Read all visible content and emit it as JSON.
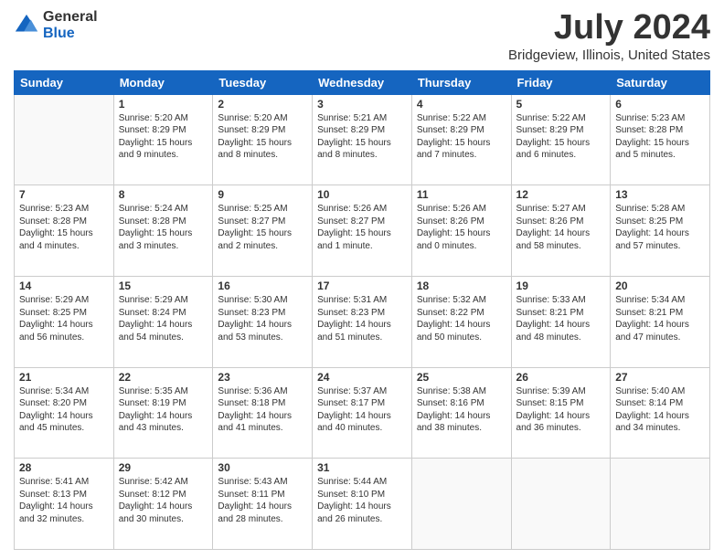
{
  "logo": {
    "general": "General",
    "blue": "Blue"
  },
  "title": "July 2024",
  "subtitle": "Bridgeview, Illinois, United States",
  "days_of_week": [
    "Sunday",
    "Monday",
    "Tuesday",
    "Wednesday",
    "Thursday",
    "Friday",
    "Saturday"
  ],
  "weeks": [
    [
      {
        "day": "",
        "info": ""
      },
      {
        "day": "1",
        "info": "Sunrise: 5:20 AM\nSunset: 8:29 PM\nDaylight: 15 hours\nand 9 minutes."
      },
      {
        "day": "2",
        "info": "Sunrise: 5:20 AM\nSunset: 8:29 PM\nDaylight: 15 hours\nand 8 minutes."
      },
      {
        "day": "3",
        "info": "Sunrise: 5:21 AM\nSunset: 8:29 PM\nDaylight: 15 hours\nand 8 minutes."
      },
      {
        "day": "4",
        "info": "Sunrise: 5:22 AM\nSunset: 8:29 PM\nDaylight: 15 hours\nand 7 minutes."
      },
      {
        "day": "5",
        "info": "Sunrise: 5:22 AM\nSunset: 8:29 PM\nDaylight: 15 hours\nand 6 minutes."
      },
      {
        "day": "6",
        "info": "Sunrise: 5:23 AM\nSunset: 8:28 PM\nDaylight: 15 hours\nand 5 minutes."
      }
    ],
    [
      {
        "day": "7",
        "info": "Sunrise: 5:23 AM\nSunset: 8:28 PM\nDaylight: 15 hours\nand 4 minutes."
      },
      {
        "day": "8",
        "info": "Sunrise: 5:24 AM\nSunset: 8:28 PM\nDaylight: 15 hours\nand 3 minutes."
      },
      {
        "day": "9",
        "info": "Sunrise: 5:25 AM\nSunset: 8:27 PM\nDaylight: 15 hours\nand 2 minutes."
      },
      {
        "day": "10",
        "info": "Sunrise: 5:26 AM\nSunset: 8:27 PM\nDaylight: 15 hours\nand 1 minute."
      },
      {
        "day": "11",
        "info": "Sunrise: 5:26 AM\nSunset: 8:26 PM\nDaylight: 15 hours\nand 0 minutes."
      },
      {
        "day": "12",
        "info": "Sunrise: 5:27 AM\nSunset: 8:26 PM\nDaylight: 14 hours\nand 58 minutes."
      },
      {
        "day": "13",
        "info": "Sunrise: 5:28 AM\nSunset: 8:25 PM\nDaylight: 14 hours\nand 57 minutes."
      }
    ],
    [
      {
        "day": "14",
        "info": "Sunrise: 5:29 AM\nSunset: 8:25 PM\nDaylight: 14 hours\nand 56 minutes."
      },
      {
        "day": "15",
        "info": "Sunrise: 5:29 AM\nSunset: 8:24 PM\nDaylight: 14 hours\nand 54 minutes."
      },
      {
        "day": "16",
        "info": "Sunrise: 5:30 AM\nSunset: 8:23 PM\nDaylight: 14 hours\nand 53 minutes."
      },
      {
        "day": "17",
        "info": "Sunrise: 5:31 AM\nSunset: 8:23 PM\nDaylight: 14 hours\nand 51 minutes."
      },
      {
        "day": "18",
        "info": "Sunrise: 5:32 AM\nSunset: 8:22 PM\nDaylight: 14 hours\nand 50 minutes."
      },
      {
        "day": "19",
        "info": "Sunrise: 5:33 AM\nSunset: 8:21 PM\nDaylight: 14 hours\nand 48 minutes."
      },
      {
        "day": "20",
        "info": "Sunrise: 5:34 AM\nSunset: 8:21 PM\nDaylight: 14 hours\nand 47 minutes."
      }
    ],
    [
      {
        "day": "21",
        "info": "Sunrise: 5:34 AM\nSunset: 8:20 PM\nDaylight: 14 hours\nand 45 minutes."
      },
      {
        "day": "22",
        "info": "Sunrise: 5:35 AM\nSunset: 8:19 PM\nDaylight: 14 hours\nand 43 minutes."
      },
      {
        "day": "23",
        "info": "Sunrise: 5:36 AM\nSunset: 8:18 PM\nDaylight: 14 hours\nand 41 minutes."
      },
      {
        "day": "24",
        "info": "Sunrise: 5:37 AM\nSunset: 8:17 PM\nDaylight: 14 hours\nand 40 minutes."
      },
      {
        "day": "25",
        "info": "Sunrise: 5:38 AM\nSunset: 8:16 PM\nDaylight: 14 hours\nand 38 minutes."
      },
      {
        "day": "26",
        "info": "Sunrise: 5:39 AM\nSunset: 8:15 PM\nDaylight: 14 hours\nand 36 minutes."
      },
      {
        "day": "27",
        "info": "Sunrise: 5:40 AM\nSunset: 8:14 PM\nDaylight: 14 hours\nand 34 minutes."
      }
    ],
    [
      {
        "day": "28",
        "info": "Sunrise: 5:41 AM\nSunset: 8:13 PM\nDaylight: 14 hours\nand 32 minutes."
      },
      {
        "day": "29",
        "info": "Sunrise: 5:42 AM\nSunset: 8:12 PM\nDaylight: 14 hours\nand 30 minutes."
      },
      {
        "day": "30",
        "info": "Sunrise: 5:43 AM\nSunset: 8:11 PM\nDaylight: 14 hours\nand 28 minutes."
      },
      {
        "day": "31",
        "info": "Sunrise: 5:44 AM\nSunset: 8:10 PM\nDaylight: 14 hours\nand 26 minutes."
      },
      {
        "day": "",
        "info": ""
      },
      {
        "day": "",
        "info": ""
      },
      {
        "day": "",
        "info": ""
      }
    ]
  ]
}
